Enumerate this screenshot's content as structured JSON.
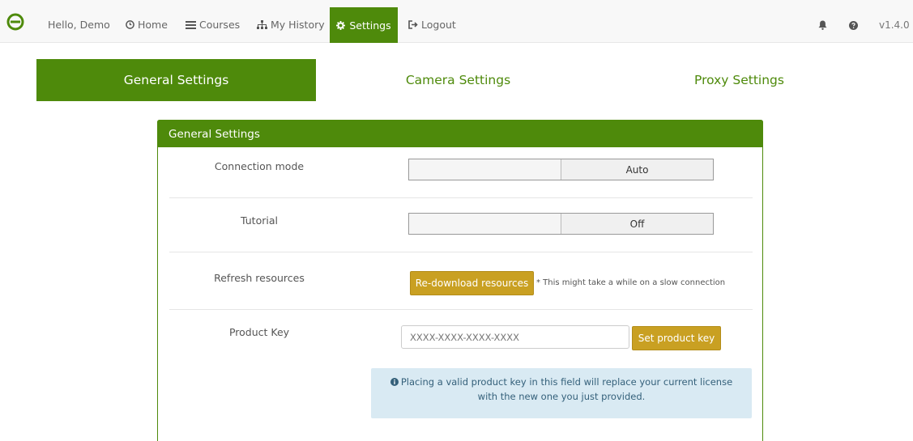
{
  "nav": {
    "greeting": "Hello, Demo",
    "home": "Home",
    "courses": "Courses",
    "history": "My History",
    "settings": "Settings",
    "logout": "Logout",
    "version": "v1.4.0"
  },
  "tabs": [
    {
      "label": "General Settings",
      "active": true
    },
    {
      "label": "Camera Settings",
      "active": false
    },
    {
      "label": "Proxy Settings",
      "active": false
    }
  ],
  "panel": {
    "title": "General Settings",
    "connection_mode": {
      "label": "Connection mode",
      "value": "Auto"
    },
    "tutorial": {
      "label": "Tutorial",
      "value": "Off"
    },
    "refresh": {
      "label": "Refresh resources",
      "button": "Re-download resources",
      "hint": "* This might take a while on a slow connection"
    },
    "product_key": {
      "label": "Product Key",
      "placeholder": "XXXX-XXXX-XXXX-XXXX",
      "button": "Set product key"
    },
    "info": "Placing a valid product key in this field will replace your current license with the new one you just provided."
  },
  "colors": {
    "brand": "#4e8a0b",
    "gold": "#c9a022",
    "info_bg": "#d9eaf3"
  }
}
